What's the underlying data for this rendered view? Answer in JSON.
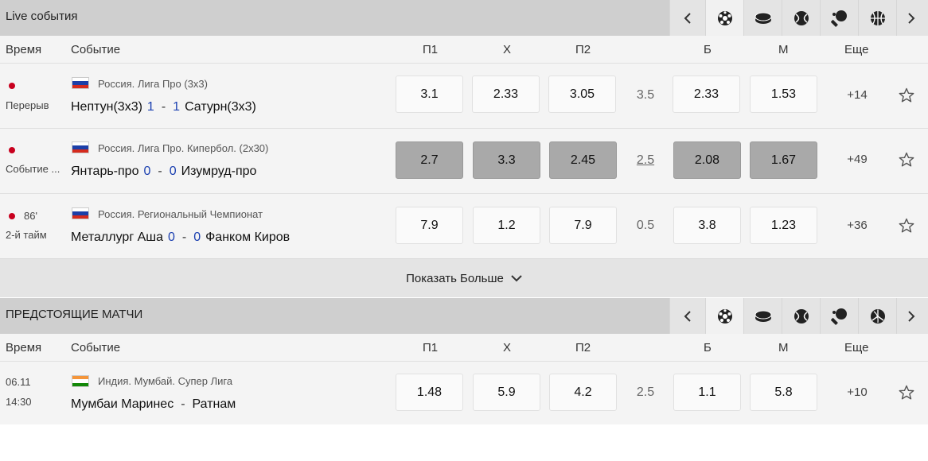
{
  "live": {
    "title": "Live события",
    "nav_icons": [
      "chevron-left-icon",
      "soccer-ball-icon",
      "hockey-puck-icon",
      "basketball-icon",
      "table-tennis-icon",
      "basketball-icon",
      "chevron-right-icon"
    ],
    "columns": {
      "time": "Время",
      "event": "Событие",
      "p1": "П1",
      "x": "Х",
      "p2": "П2",
      "b": "Б",
      "m": "М",
      "more": "Еще"
    },
    "matches": [
      {
        "status": "Перерыв",
        "minute": "",
        "flag": "russia",
        "league": "Россия. Лига Про (3х3)",
        "home": "Нептун(3х3)",
        "home_score": "1",
        "away_score": "1",
        "away": "Сатурн(3х3)",
        "p1": "3.1",
        "x": "2.33",
        "p2": "3.05",
        "total": "3.5",
        "b": "2.33",
        "m": "1.53",
        "more": "+14",
        "locked": false
      },
      {
        "status": "Событие ...",
        "minute": "",
        "flag": "russia",
        "league": "Россия. Лига Про. Кипербол. (2х30)",
        "home": "Янтарь-про",
        "home_score": "0",
        "away_score": "0",
        "away": "Изумруд-про",
        "p1": "2.7",
        "x": "3.3",
        "p2": "2.45",
        "total": "2.5",
        "b": "2.08",
        "m": "1.67",
        "more": "+49",
        "locked": true
      },
      {
        "status": "2-й тайм",
        "minute": "86'",
        "flag": "russia",
        "league": "Россия. Региональный Чемпионат",
        "home": "Металлург Аша",
        "home_score": "0",
        "away_score": "0",
        "away": "Фанком Киров",
        "p1": "7.9",
        "x": "1.2",
        "p2": "7.9",
        "total": "0.5",
        "b": "3.8",
        "m": "1.23",
        "more": "+36",
        "locked": false
      }
    ],
    "show_more": "Показать Больше"
  },
  "upcoming": {
    "title": "ПРЕДСТОЯЩИЕ МАТЧИ",
    "nav_icons": [
      "chevron-left-icon",
      "soccer-ball-icon",
      "hockey-puck-icon",
      "basketball-icon",
      "table-tennis-icon",
      "volleyball-icon",
      "chevron-right-icon"
    ],
    "columns": {
      "time": "Время",
      "event": "Событие",
      "p1": "П1",
      "x": "Х",
      "p2": "П2",
      "b": "Б",
      "m": "М",
      "more": "Еще"
    },
    "matches": [
      {
        "date": "06.11",
        "time": "14:30",
        "flag": "india",
        "league": "Индия. Мумбай. Супер Лига",
        "home": "Мумбаи Маринес",
        "away": "Ратнам",
        "p1": "1.48",
        "x": "5.9",
        "p2": "4.2",
        "total": "2.5",
        "b": "1.1",
        "m": "5.8",
        "more": "+10"
      }
    ]
  },
  "colors": {
    "live_dot": "#c8001e",
    "score": "#1a3fb0",
    "locked_odd": "#a9a9a9"
  }
}
